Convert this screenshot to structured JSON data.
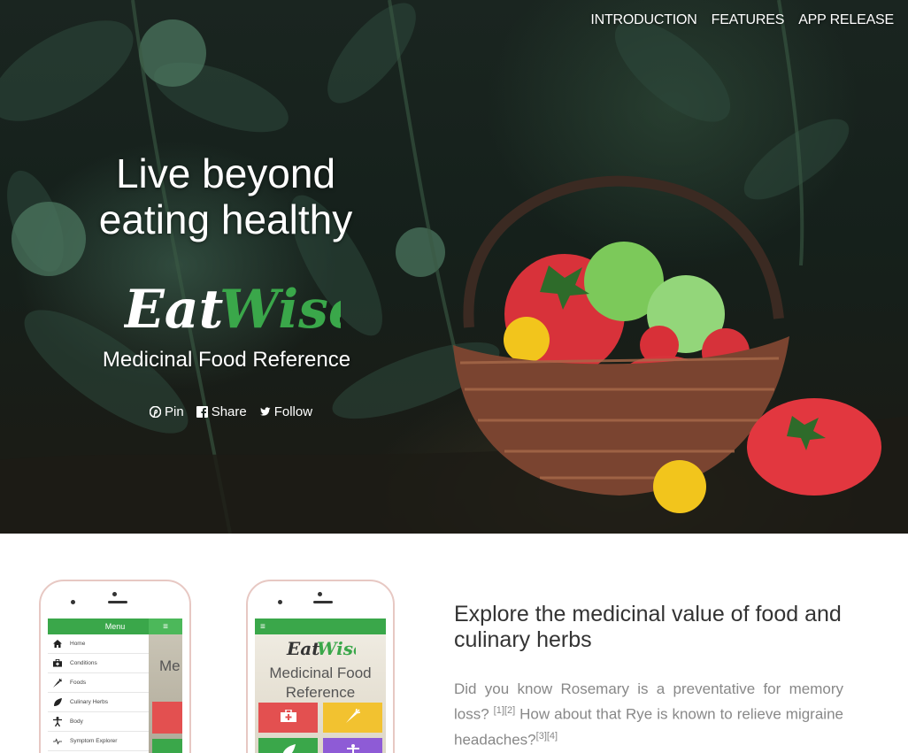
{
  "nav": {
    "items": [
      "INTRODUCTION",
      "FEATURES",
      "APP RELEASE"
    ]
  },
  "hero": {
    "headline_line1": "Live beyond",
    "headline_line2": "eating healthy",
    "logo_word1": "Eat",
    "logo_word2": "Wise",
    "subtitle": "Medicinal Food Reference",
    "social": {
      "pin": "Pin",
      "share": "Share",
      "follow": "Follow"
    }
  },
  "phone_menu": {
    "title": "Menu",
    "hamburger": "≡",
    "items": [
      "Home",
      "Conditions",
      "Foods",
      "Culinary Herbs",
      "Body",
      "Symptom Explorer"
    ],
    "side_text": "Me"
  },
  "phone_home": {
    "hamburger": "≡",
    "logo_word1": "Eat",
    "logo_word2": "Wise",
    "subtitle_line1": "Medicinal Food",
    "subtitle_line2": "Reference"
  },
  "explore": {
    "title": "Explore the medicinal value of food and culinary herbs",
    "text_part1": "Did you know Rosemary is a preventative for memory loss?",
    "ref1": "[1][2]",
    "text_part2": " How about that Rye is known to relieve migraine headaches?",
    "ref2": "[3][4]"
  },
  "colors": {
    "brand_green": "#3aa74a",
    "tile_red": "#e35050",
    "tile_yellow": "#f2c230",
    "tile_green": "#3aa74a",
    "tile_purple": "#8e5bd6"
  },
  "icons": [
    "pinterest-icon",
    "facebook-icon",
    "twitter-icon",
    "home-icon",
    "medkit-icon",
    "carrot-icon",
    "leaf-icon",
    "body-icon",
    "pulse-icon",
    "hamburger-icon"
  ]
}
